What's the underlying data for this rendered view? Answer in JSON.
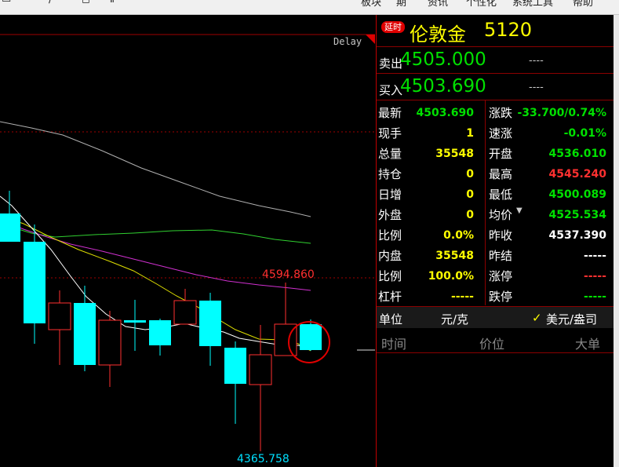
{
  "toolbar": {
    "menu_1": "板块",
    "menu_2": "期",
    "menu_3": "资讯",
    "menu_4": "个性化",
    "menu_5": "系统工具",
    "menu_6": "帮助"
  },
  "chart": {
    "delay_label": "Delay",
    "high_label": "4594.860",
    "low_label": "4365.758"
  },
  "quote": {
    "delay_badge": "延时",
    "name": "伦敦金",
    "code": "5120",
    "sell_label": "卖出",
    "sell_price": "4505.000",
    "sell_vol": "----",
    "buy_label": "买入",
    "buy_price": "4503.690",
    "buy_vol": "----",
    "left_rows": [
      {
        "label": "最新",
        "value": "4503.690"
      },
      {
        "label": "现手",
        "value": "1"
      },
      {
        "label": "总量",
        "value": "35548"
      },
      {
        "label": "持仓",
        "value": "0"
      },
      {
        "label": "日增",
        "value": "0"
      },
      {
        "label": "外盘",
        "value": "0"
      },
      {
        "label": "比例",
        "value": "0.0%"
      },
      {
        "label": "内盘",
        "value": "35548"
      },
      {
        "label": "比例",
        "value": "100.0%"
      },
      {
        "label": "杠杆",
        "value": "-----"
      }
    ],
    "right_rows": [
      {
        "label": "涨跌",
        "value": "-33.700/0.74%"
      },
      {
        "label": "速涨",
        "value": "-0.01%"
      },
      {
        "label": "开盘",
        "value": "4536.010"
      },
      {
        "label": "最高",
        "value": "4545.240"
      },
      {
        "label": "最低",
        "value": "4500.089"
      },
      {
        "label": "均价",
        "value": "4525.534"
      },
      {
        "label": "昨收",
        "value": "4537.390"
      },
      {
        "label": "昨结",
        "value": "-----"
      },
      {
        "label": "涨停",
        "value": "-----"
      },
      {
        "label": "跌停",
        "value": "-----"
      }
    ],
    "unit_label": "单位",
    "unit_value": "元/克",
    "unit_check": "✓",
    "currency": "美元/盎司",
    "trade_headers": {
      "time": "时间",
      "price": "价位",
      "volume": "大单"
    }
  },
  "colors": {
    "up": "#ff3030",
    "down": "#00ffff",
    "green": "#00e000",
    "yellow": "#ffff00"
  }
}
